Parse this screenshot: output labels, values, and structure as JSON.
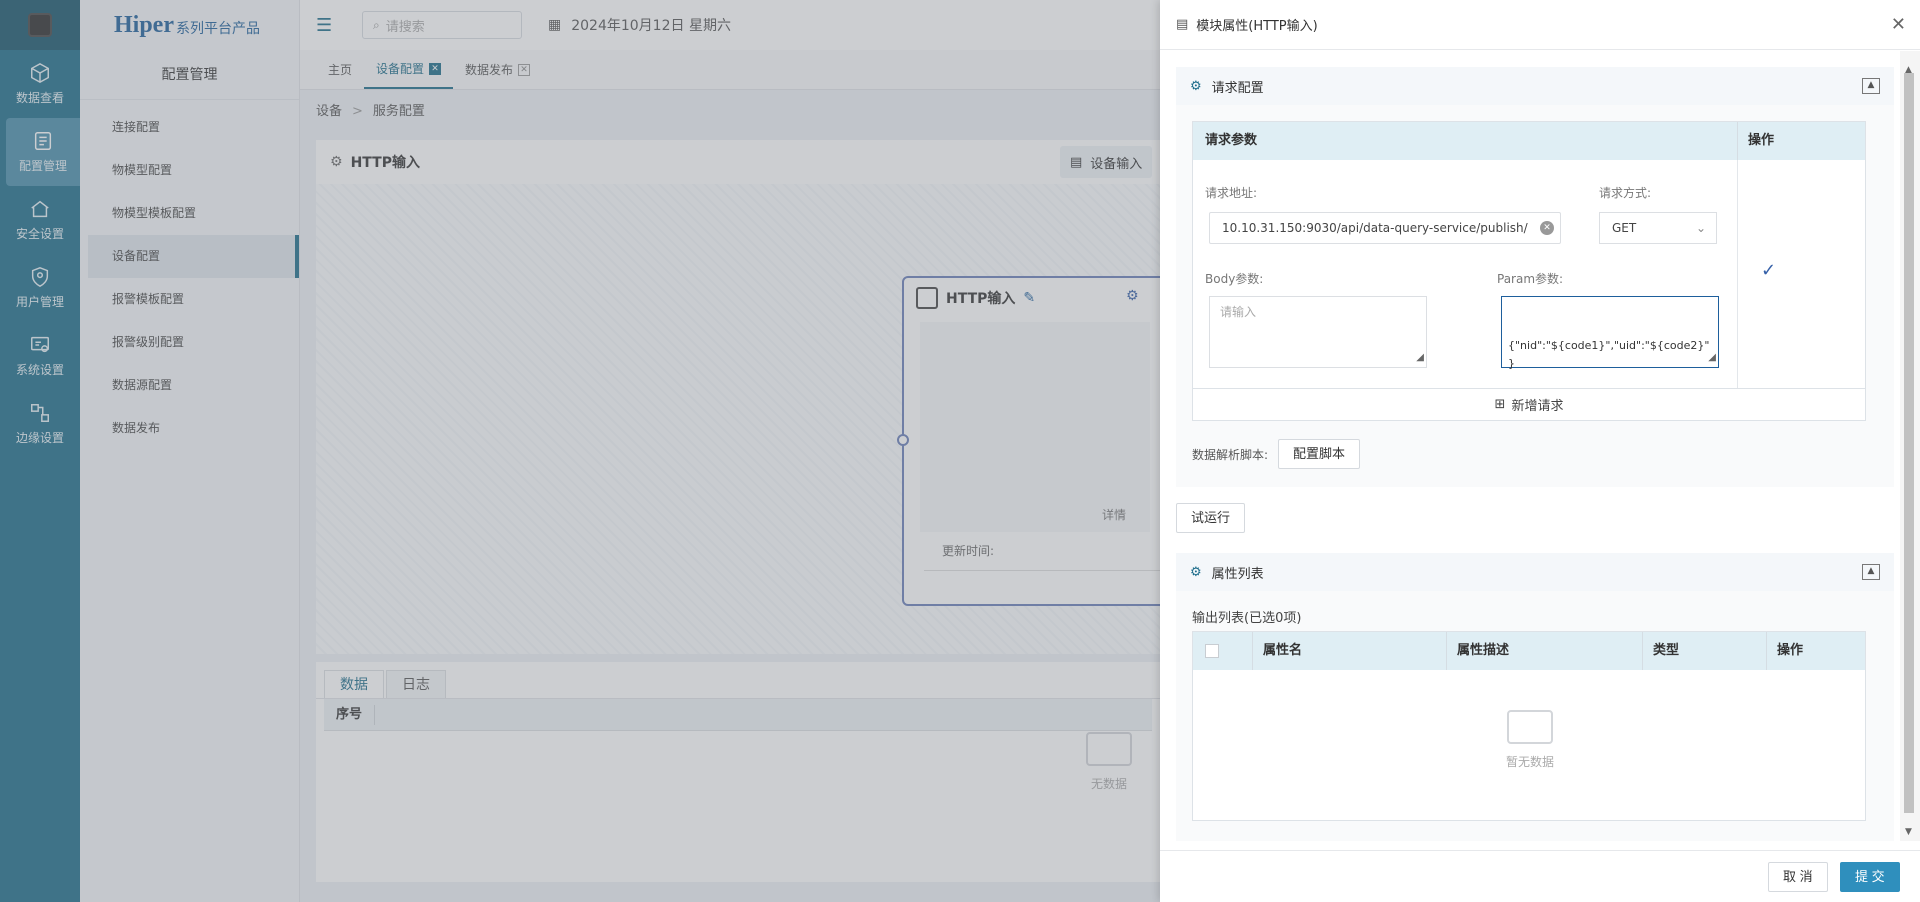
{
  "rail": {
    "items": [
      {
        "label": "数据查看",
        "icon": "cube-icon"
      },
      {
        "label": "配置管理",
        "icon": "config-icon"
      },
      {
        "label": "安全设置",
        "icon": "house-shield-icon"
      },
      {
        "label": "用户管理",
        "icon": "user-shield-icon"
      },
      {
        "label": "系统设置",
        "icon": "system-icon"
      },
      {
        "label": "边缘设置",
        "icon": "edge-icon"
      }
    ]
  },
  "brand": {
    "main": "Hiper",
    "sub": "系列平台产品"
  },
  "subbar": {
    "title": "配置管理",
    "items": [
      "连接配置",
      "物模型配置",
      "物模型模板配置",
      "设备配置",
      "报警模板配置",
      "报警级别配置",
      "数据源配置",
      "数据发布"
    ]
  },
  "topbar": {
    "search_placeholder": "请搜索",
    "date": "2024年10月12日 星期六"
  },
  "tabs": [
    {
      "label": "主页"
    },
    {
      "label": "设备配置"
    },
    {
      "label": "数据发布"
    }
  ],
  "breadcrumb": {
    "part1": "设备",
    "part2": "服务配置"
  },
  "panel": {
    "title": "HTTP输入",
    "device_btn": "设备输入"
  },
  "node": {
    "title": "HTTP输入",
    "detail": "详情",
    "updated": "更新时间:"
  },
  "bottom": {
    "tab_data": "数据",
    "tab_log": "日志",
    "col_index": "序号",
    "nodata": "无数据"
  },
  "drawer": {
    "title": "模块属性(HTTP输入)",
    "request_section": "请求配置",
    "req_table": {
      "col_params": "请求参数",
      "col_ops": "操作"
    },
    "url_label": "请求地址:",
    "url_value": "10.10.31.150:9030/api/data-query-service/publish/",
    "method_label": "请求方式:",
    "method_value": "GET",
    "body_label": "Body参数:",
    "body_placeholder": "请输入",
    "param_label": "Param参数:",
    "param_value": "{\"nid\":\"${code1}\",\"uid\":\"${code2}\"\n}",
    "add_request": "新增请求",
    "script_label": "数据解析脚本:",
    "script_btn": "配置脚本",
    "trial_btn": "试运行",
    "attr_section": "属性列表",
    "attr_sub": "输出列表(已选0项)",
    "attr_cols": [
      "属性名",
      "属性描述",
      "类型",
      "操作"
    ],
    "attr_empty": "暂无数据",
    "cancel": "取 消",
    "submit": "提 交"
  }
}
